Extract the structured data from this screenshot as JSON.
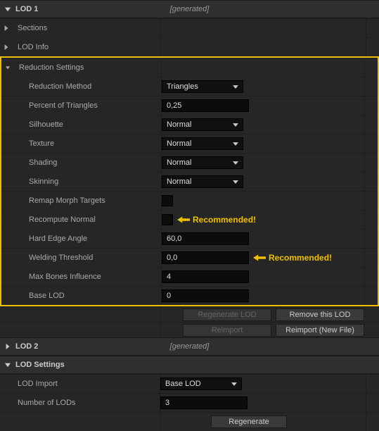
{
  "lod1": {
    "title": "LOD 1",
    "tag": "[generated]"
  },
  "sections_row": {
    "label": "Sections"
  },
  "lodinfo_row": {
    "label": "LOD Info"
  },
  "reduction": {
    "title": "Reduction Settings",
    "method": {
      "label": "Reduction Method",
      "value": "Triangles"
    },
    "percent": {
      "label": "Percent of Triangles",
      "value": "0,25"
    },
    "silhouette": {
      "label": "Silhouette",
      "value": "Normal"
    },
    "texture": {
      "label": "Texture",
      "value": "Normal"
    },
    "shading": {
      "label": "Shading",
      "value": "Normal"
    },
    "skinning": {
      "label": "Skinning",
      "value": "Normal"
    },
    "remap": {
      "label": "Remap Morph Targets"
    },
    "recompute": {
      "label": "Recompute Normal",
      "annot": "Recommended!"
    },
    "hardedge": {
      "label": "Hard Edge Angle",
      "value": "60,0"
    },
    "welding": {
      "label": "Welding Threshold",
      "value": "0,0",
      "annot": "Recommended!"
    },
    "maxbones": {
      "label": "Max Bones Influence",
      "value": "4"
    },
    "baselod": {
      "label": "Base LOD",
      "value": "0"
    }
  },
  "buttons1": {
    "regen": "Regenerate LOD",
    "remove": "Remove this LOD"
  },
  "buttons2": {
    "reimport": "Reimport",
    "reimport_new": "Reimport (New File)"
  },
  "lod2": {
    "title": "LOD 2",
    "tag": "[generated]"
  },
  "lodsettings": {
    "title": "LOD Settings",
    "import": {
      "label": "LOD Import",
      "value": "Base LOD"
    },
    "num": {
      "label": "Number of LODs",
      "value": "3"
    },
    "regen": "Regenerate"
  }
}
